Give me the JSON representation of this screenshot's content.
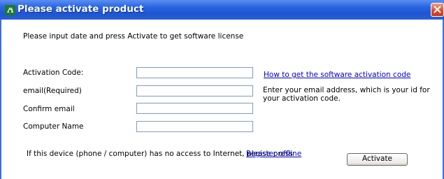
{
  "window": {
    "title": "Please activate product"
  },
  "intro_text": "Please input date and press Activate to get software license",
  "fields": {
    "activation_code": {
      "label": "Activation Code:",
      "value": ""
    },
    "email": {
      "label": "email(Required)",
      "value": ""
    },
    "confirm_email": {
      "label": "Confirm email",
      "value": ""
    },
    "computer_name": {
      "label": "Computer Name",
      "value": ""
    }
  },
  "help_link": "How to get the software activation code",
  "email_hint": "Enter your email address, which is your id for your activation code.",
  "offline": {
    "text": "If this device (phone / computer) has no access to Internet, please press",
    "link": "Register offline"
  },
  "activate_button": "Activate",
  "colors": {
    "titlebar": "#2a66e2",
    "link": "#0000cc",
    "input_border": "#7f9db9",
    "close_button": "#d84a2a"
  },
  "icons": {
    "app_icon": "app-icon",
    "close_icon": "close-icon"
  }
}
